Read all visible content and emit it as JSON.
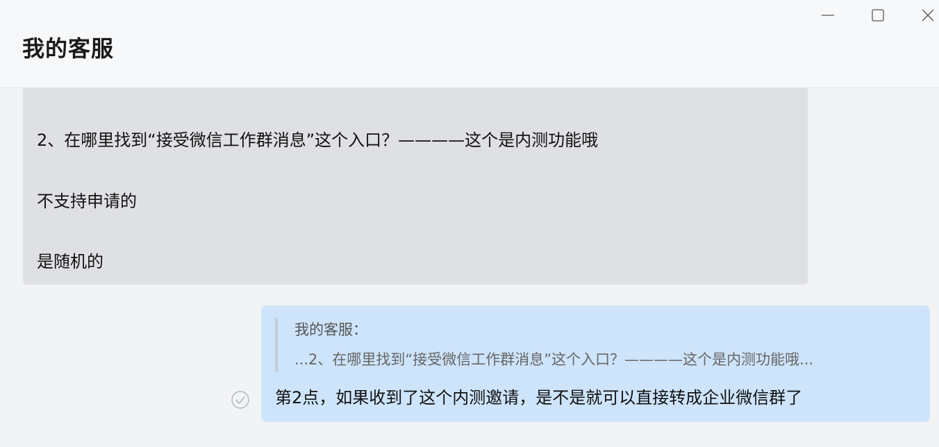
{
  "window": {
    "title": "我的客服",
    "controls": {
      "minimize_icon": "minimize-icon",
      "maximize_icon": "maximize-icon",
      "close_icon": "close-icon"
    }
  },
  "messages": {
    "incoming": {
      "lines": [
        "2、在哪里找到“接受微信工作群消息”这个入口？————这个是内测功能哦",
        "不支持申请的",
        "是随机的"
      ],
      "background": "#dfe0e3"
    },
    "outgoing": {
      "quote": {
        "author": "我的客服：",
        "text": "...2、在哪里找到“接受微信工作群消息”这个入口？————这个是内测功能哦..."
      },
      "text": "第2点，如果收到了这个内测邀请，是不是就可以直接转成企业微信群了",
      "status_icon": "read-check-icon",
      "background": "#cde4fb"
    }
  }
}
